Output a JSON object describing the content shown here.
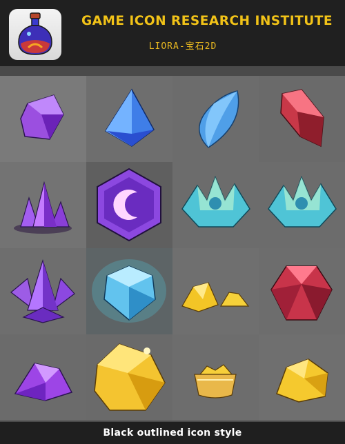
{
  "header": {
    "title": "GAME ICON RESEARCH INSTITUTE",
    "subtitle": "LIORA-宝石2D",
    "logo_icon": "potion-bottle-icon"
  },
  "footer": {
    "caption": "Black outlined icon style"
  },
  "colors": {
    "header_bg": "#202020",
    "title_color": "#f2c318",
    "grid_bg": "#4a4a4a",
    "footer_bg": "#1f1f1f",
    "caption_color": "#ffffff"
  },
  "gems": [
    {
      "icon": "purple-crystal-icon"
    },
    {
      "icon": "blue-triangular-gem-icon"
    },
    {
      "icon": "blue-leaf-gem-icon"
    },
    {
      "icon": "red-crystal-icon"
    },
    {
      "icon": "purple-crystal-cluster-icon"
    },
    {
      "icon": "purple-hexagon-moon-icon"
    },
    {
      "icon": "teal-crystal-flower-icon"
    },
    {
      "icon": "teal-crystal-flower-icon"
    },
    {
      "icon": "purple-crystal-spikes-icon"
    },
    {
      "icon": "glowing-blue-gem-icon"
    },
    {
      "icon": "gold-nuggets-icon"
    },
    {
      "icon": "red-faceted-gem-icon"
    },
    {
      "icon": "purple-gem-rock-icon"
    },
    {
      "icon": "large-gold-crystal-icon"
    },
    {
      "icon": "gold-gems-bowl-icon"
    },
    {
      "icon": "gold-rock-icon"
    }
  ]
}
